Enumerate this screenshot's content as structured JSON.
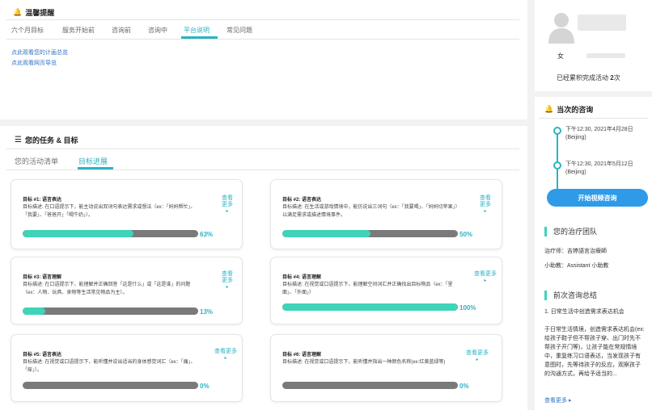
{
  "tips": {
    "title": "温馨提醒",
    "tabs": [
      "六个月目标",
      "服务开始前",
      "咨询前",
      "咨询中",
      "平台说明",
      "常见问题"
    ],
    "active_tab": 4,
    "links": [
      "点此观看您的计画总览",
      "点此观看网页导览"
    ]
  },
  "tasks": {
    "title": "您的任务 & 目标",
    "subtabs": [
      "您的活动清单",
      "目标进展"
    ],
    "active_subtab": 1,
    "cards": [
      {
        "title": "目标 #1: 语言表达",
        "desc": "目标描述: 在口语提示下，能主动说出双词句表达需求或想法（ex：「妈妈帮忙」、「我要」、「爸爸开」「喝牛奶」）。",
        "more": "查看更多",
        "progress": 0.63,
        "pct_label": "63%"
      },
      {
        "title": "目标 #2: 语言表达",
        "desc": "目标描述: 在生活或游戏情境中，能仿说出三词句（ex：「我要喝」、「妈妈切苹果」）以满足需求或描述情境事件。",
        "more": "查看更多",
        "progress": 0.5,
        "pct_label": "50%"
      },
      {
        "title": "目标 #3: 语言理解",
        "desc": "目标描述: 在口语提示下，能理解并正确回答「这是什么」或「这是谁」的问题（ex：人物、玩具、食物等生活常见物品为主）。",
        "more": "查看更多",
        "progress": 0.13,
        "pct_label": "13%"
      },
      {
        "title": "目标 #4: 语言理解",
        "desc": "目标描述: 在视觉或口语提示下，能理解空间词汇并正确找出目标物品（ex：「里面」、「外面」）",
        "more": "查看更多",
        "progress": 1.0,
        "pct_label": "100%"
      },
      {
        "title": "目标 #5: 语言表达",
        "desc": "目标描述: 在视觉或口语提示下，能听懂并说出适当的身体感觉词汇（ex：「痛」、「痒」）。",
        "more": "查看更多",
        "progress": 0.0,
        "pct_label": "0%"
      },
      {
        "title": "目标 #6: 语言理解",
        "desc": "目标描述: 在视觉或口语提示下，能听懂并指出一种颜色名称(ex:红黄蓝绿等)",
        "more": "查看更多",
        "progress": 0.0,
        "pct_label": "0%"
      }
    ]
  },
  "profile": {
    "gender": "女",
    "completed_prefix": "已经累积完成活动 ",
    "completed_count": "2",
    "completed_suffix": "次"
  },
  "consult": {
    "title": "当次的咨询",
    "sessions": [
      "下午12:30, 2021年4月28日 (Beijing)",
      "下午12:30, 2021年5月12日 (Beijing)"
    ],
    "button": "开始视频咨询",
    "team_heading": "您的治疗团队",
    "therapist": "治疗师：吉婷語言治療師",
    "assistant": "小助教：Assistant 小助教",
    "summary_heading": "前次咨询总结",
    "summary_first": "1. 日常生活中创造需求表达机会",
    "summary_body": "于日常生活情境，创造需求表达机会(ex:给孩子鞋子但不帮孩子穿、出门时先不帮孩子开门等)，让孩子能在常规情境中，重复练习口语表达，当发现孩子有意图时，先等待孩子的反应，观察孩子的沟通方式，再给予适当的...",
    "more": "查看更多 ▸"
  },
  "colors": {
    "accent": "#2bb3c4",
    "progress": "#3fd3b8",
    "button": "#2f9be8"
  }
}
